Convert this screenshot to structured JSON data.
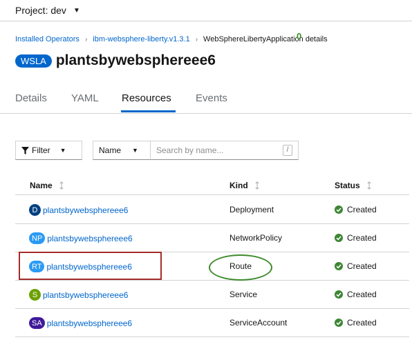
{
  "project": {
    "label": "Project: dev"
  },
  "breadcrumb": {
    "items": [
      "Installed Operators",
      "ibm-websphere-liberty.v1.3.1"
    ],
    "current": "WebSphereLibertyApplication details"
  },
  "header": {
    "badge": "WSLA",
    "title": "plantsbywebsphereee6"
  },
  "tabs": [
    {
      "label": "Details"
    },
    {
      "label": "YAML"
    },
    {
      "label": "Resources",
      "active": true
    },
    {
      "label": "Events"
    }
  ],
  "toolbar": {
    "filter_label": "Filter",
    "name_select": "Name",
    "search_placeholder": "Search by name...",
    "search_shortcut": "/"
  },
  "table": {
    "columns": [
      "Name",
      "Kind",
      "Status"
    ],
    "rows": [
      {
        "badge": "D",
        "badge_color": "#004080",
        "name": "plantsbywebsphereee6",
        "kind": "Deployment",
        "status": "Created"
      },
      {
        "badge": "NP",
        "badge_color": "#2b9af3",
        "name": "plantsbywebsphereee6",
        "kind": "NetworkPolicy",
        "status": "Created"
      },
      {
        "badge": "RT",
        "badge_color": "#2b9af3",
        "name": "plantsbywebsphereee6",
        "kind": "Route",
        "status": "Created"
      },
      {
        "badge": "S",
        "badge_color": "#6ca100",
        "name": "plantsbywebsphereee6",
        "kind": "Service",
        "status": "Created"
      },
      {
        "badge": "SA",
        "badge_color": "#40199a",
        "name": "plantsbywebsphereee6",
        "kind": "ServiceAccount",
        "status": "Created"
      }
    ]
  },
  "annotation": {
    "mark": "0"
  },
  "colors": {
    "link": "#0066cc",
    "success": "#3e8635",
    "annotation_rect": "#a52a2a",
    "annotation_ellipse": "#3b8a2a"
  }
}
